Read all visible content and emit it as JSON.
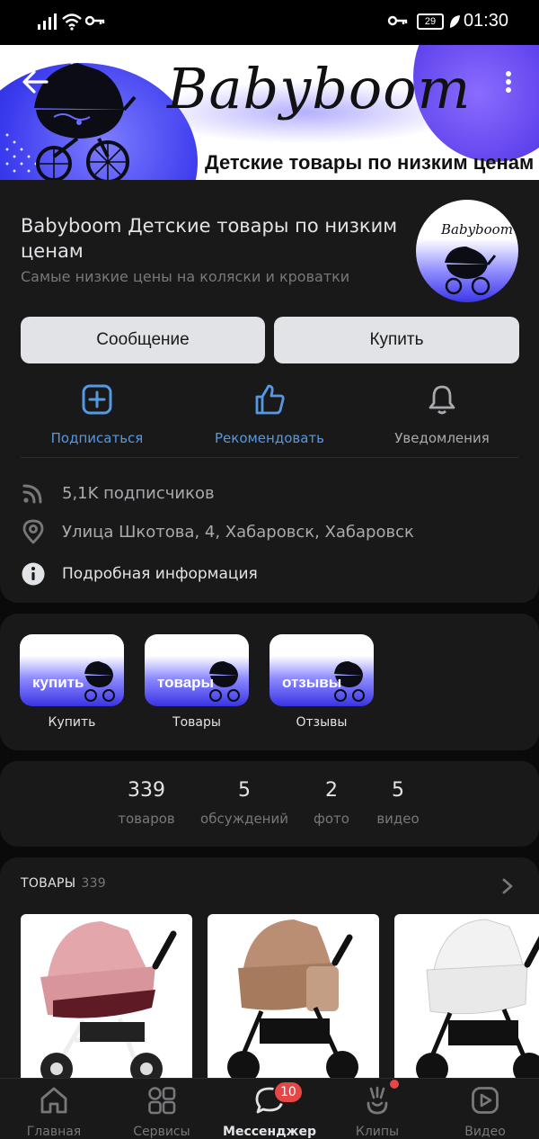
{
  "statusbar": {
    "time": "01:30",
    "battery": "29"
  },
  "cover": {
    "brand": "Babyboom",
    "subtitle": "Детские товары по  низким ценам"
  },
  "group": {
    "name": "Babyboom  Детские товары по низким ценам",
    "status": "Самые низкие цены на коляски и кроватки",
    "avatar_text": "Babyboom"
  },
  "buttons": {
    "message": "Сообщение",
    "buy": "Купить"
  },
  "actions": [
    {
      "label": "Подписаться",
      "icon": "plus-square-icon"
    },
    {
      "label": "Рекомендовать",
      "icon": "thumbs-up-icon"
    },
    {
      "label": "Уведомления",
      "icon": "bell-icon"
    }
  ],
  "info": {
    "subscribers": "5,1K подписчиков",
    "address": "Улица Шкотова, 4, Хабаровск, Хабаровск",
    "details": "Подробная информация"
  },
  "links": [
    {
      "tile_text": "купить",
      "label": "Купить"
    },
    {
      "tile_text": "товары",
      "label": "Товары"
    },
    {
      "tile_text": "отзывы",
      "label": "Отзывы"
    }
  ],
  "counters": [
    {
      "value": "339",
      "caption": "товаров"
    },
    {
      "value": "5",
      "caption": "обсуждений"
    },
    {
      "value": "2",
      "caption": "фото"
    },
    {
      "value": "5",
      "caption": "видео"
    }
  ],
  "products": {
    "title": "ТОВАРЫ",
    "count": "339"
  },
  "tabs": [
    {
      "label": "Главная",
      "icon": "home-icon"
    },
    {
      "label": "Сервисы",
      "icon": "services-icon"
    },
    {
      "label": "Мессенджер",
      "icon": "messenger-icon"
    },
    {
      "label": "Клипы",
      "icon": "clips-icon"
    },
    {
      "label": "Видео",
      "icon": "video-icon"
    }
  ],
  "messenger_badge": "10",
  "colors": {
    "accent": "#5599e4",
    "badge": "#e64646",
    "card": "#19191a",
    "background": "#0a0a0a"
  }
}
